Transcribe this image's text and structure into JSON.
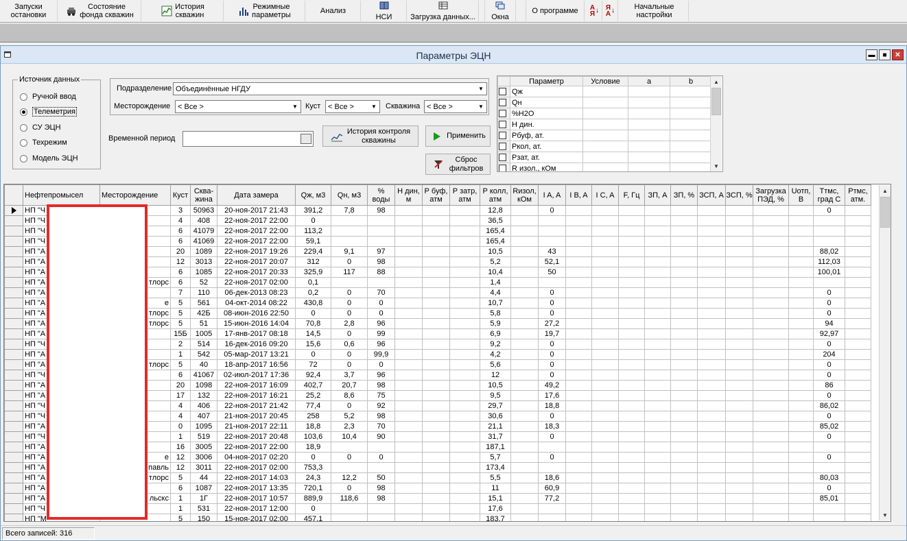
{
  "toolbar": {
    "buttons": [
      {
        "label": "Запуски\nостановки",
        "icon": ""
      },
      {
        "label": "Состояние\nфонда скважин",
        "icon": "car-icon"
      },
      {
        "label": "История\nскважин",
        "icon": "chart-history-icon"
      },
      {
        "label": "Режимные\nпараметры",
        "icon": "bar-chart-icon"
      },
      {
        "label": "Анализ",
        "icon": ""
      },
      {
        "label": "НСИ",
        "icon": "book-icon"
      },
      {
        "label": "Загрузка данных...",
        "icon": "grid-load-icon"
      },
      {
        "label": "Окна",
        "icon": "windows-icon"
      },
      {
        "label": "О программе",
        "icon": ""
      },
      {
        "label": "",
        "icon": "sort-ascending-icon"
      },
      {
        "label": "",
        "icon": "sort-descending-icon"
      },
      {
        "label": "Начальные\nнастройки",
        "icon": ""
      }
    ]
  },
  "window": {
    "title": "Параметры ЭЦН"
  },
  "source": {
    "legend": "Источник данных",
    "options": [
      "Ручной ввод",
      "Телеметрия",
      "СУ ЭЦН",
      "Техрежим",
      "Модель ЭЦН"
    ],
    "selected": "Телеметрия"
  },
  "filters": {
    "division_label": "Подразделение",
    "division_value": "Объединённые НГДУ",
    "field_label": "Месторождение",
    "field_value": "< Все >",
    "pad_label": "Куст",
    "pad_value": "< Все >",
    "well_label": "Скважина",
    "well_value": "< Все >",
    "period_label": "Временной период",
    "period_value": ""
  },
  "buttons": {
    "history": "История контроля\nскважины",
    "apply": "Применить",
    "reset": "Сброс\nфильтров"
  },
  "conditions": {
    "headers": [
      "Параметр",
      "Условие",
      "a",
      "b"
    ],
    "rows": [
      "Qж",
      "Qн",
      "%H2O",
      "Н дин.",
      "Рбуф, ат.",
      "Ркол, ат.",
      "Рзат, ат.",
      "R изол., кОм"
    ]
  },
  "grid": {
    "headers": [
      "Нефтепромысел",
      "Месторождение",
      "Куст",
      "Сква-\nжина",
      "Дата замера",
      "Qж, м3",
      "Qн, м3",
      "%\nводы",
      "Н дин,\nм",
      "Р буф,\nатм",
      "Р затр,\nатм",
      "Р колл,\nатм",
      "Rизол,\nкОм",
      "I A, A",
      "I B, A",
      "I C, A",
      "F, Гц",
      "ЗП, А",
      "ЗП, %",
      "ЗСП, А",
      "ЗСП, %",
      "Загрузка\nПЭД, %",
      "Uотп,\nВ",
      "Ттмс,\nград С",
      "Ртмс,\nатм."
    ],
    "rows": [
      [
        "НП \"Ч",
        "",
        "3",
        "50963",
        "20-ноя-2017 21:43",
        "391,2",
        "7,8",
        "98",
        "",
        "",
        "",
        "12,8",
        "",
        "0",
        "",
        "",
        "",
        "",
        "",
        "",
        "",
        "",
        "",
        "0",
        ""
      ],
      [
        "НП \"Ч",
        "",
        "4",
        "408",
        "22-ноя-2017 22:00",
        "0",
        "",
        "",
        "",
        "",
        "",
        "36,5",
        "",
        "",
        "",
        "",
        "",
        "",
        "",
        "",
        "",
        "",
        "",
        "",
        ""
      ],
      [
        "НП \"Ч",
        "",
        "6",
        "41079",
        "22-ноя-2017 22:00",
        "113,2",
        "",
        "",
        "",
        "",
        "",
        "165,4",
        "",
        "",
        "",
        "",
        "",
        "",
        "",
        "",
        "",
        "",
        "",
        "",
        ""
      ],
      [
        "НП \"Ч",
        "",
        "6",
        "41069",
        "22-ноя-2017 22:00",
        "59,1",
        "",
        "",
        "",
        "",
        "",
        "165,4",
        "",
        "",
        "",
        "",
        "",
        "",
        "",
        "",
        "",
        "",
        "",
        "",
        ""
      ],
      [
        "НП \"А",
        "",
        "20",
        "1089",
        "22-ноя-2017 19:26",
        "229,4",
        "9,1",
        "97",
        "",
        "",
        "",
        "10,5",
        "",
        "43",
        "",
        "",
        "",
        "",
        "",
        "",
        "",
        "",
        "",
        "88,02",
        ""
      ],
      [
        "НП \"А",
        "",
        "12",
        "3013",
        "22-ноя-2017 20:07",
        "312",
        "0",
        "98",
        "",
        "",
        "",
        "5,2",
        "",
        "52,1",
        "",
        "",
        "",
        "",
        "",
        "",
        "",
        "",
        "",
        "112,03",
        ""
      ],
      [
        "НП \"А",
        "",
        "6",
        "1085",
        "22-ноя-2017 20:33",
        "325,9",
        "117",
        "88",
        "",
        "",
        "",
        "10,4",
        "",
        "50",
        "",
        "",
        "",
        "",
        "",
        "",
        "",
        "",
        "",
        "100,01",
        ""
      ],
      [
        "НП \"А",
        "тлорс",
        "6",
        "52",
        "22-ноя-2017 02:00",
        "0,1",
        "",
        "",
        "",
        "",
        "",
        "1,4",
        "",
        "",
        "",
        "",
        "",
        "",
        "",
        "",
        "",
        "",
        "",
        "",
        ""
      ],
      [
        "НП \"А",
        "",
        "7",
        "110",
        "06-дек-2013 08:23",
        "0,2",
        "0",
        "70",
        "",
        "",
        "",
        "4,4",
        "",
        "0",
        "",
        "",
        "",
        "",
        "",
        "",
        "",
        "",
        "",
        "0",
        ""
      ],
      [
        "НП \"А",
        "е",
        "5",
        "561",
        "04-окт-2014 08:22",
        "430,8",
        "0",
        "0",
        "",
        "",
        "",
        "10,7",
        "",
        "0",
        "",
        "",
        "",
        "",
        "",
        "",
        "",
        "",
        "",
        "0",
        ""
      ],
      [
        "НП \"А",
        "тлорс",
        "5",
        "42Б",
        "08-июн-2016 22:50",
        "0",
        "0",
        "0",
        "",
        "",
        "",
        "5,8",
        "",
        "0",
        "",
        "",
        "",
        "",
        "",
        "",
        "",
        "",
        "",
        "0",
        ""
      ],
      [
        "НП \"А",
        "тлорс",
        "5",
        "51",
        "15-июн-2016 14:04",
        "70,8",
        "2,8",
        "96",
        "",
        "",
        "",
        "5,9",
        "",
        "27,2",
        "",
        "",
        "",
        "",
        "",
        "",
        "",
        "",
        "",
        "94",
        ""
      ],
      [
        "НП \"А",
        "",
        "15Б",
        "1005",
        "17-янв-2017 08:18",
        "14,5",
        "0",
        "99",
        "",
        "",
        "",
        "6,9",
        "",
        "19,7",
        "",
        "",
        "",
        "",
        "",
        "",
        "",
        "",
        "",
        "92,97",
        ""
      ],
      [
        "НП \"Ч",
        "",
        "2",
        "514",
        "16-дек-2016 09:20",
        "15,6",
        "0,6",
        "96",
        "",
        "",
        "",
        "9,2",
        "",
        "0",
        "",
        "",
        "",
        "",
        "",
        "",
        "",
        "",
        "",
        "0",
        ""
      ],
      [
        "НП \"А",
        "",
        "1",
        "542",
        "05-мар-2017 13:21",
        "0",
        "0",
        "99,9",
        "",
        "",
        "",
        "4,2",
        "",
        "0",
        "",
        "",
        "",
        "",
        "",
        "",
        "",
        "",
        "",
        "204",
        ""
      ],
      [
        "НП \"А",
        "тлорс",
        "5",
        "40",
        "18-апр-2017 16:56",
        "72",
        "0",
        "0",
        "",
        "",
        "",
        "5,6",
        "",
        "0",
        "",
        "",
        "",
        "",
        "",
        "",
        "",
        "",
        "",
        "0",
        ""
      ],
      [
        "НП \"Ч",
        "",
        "6",
        "41067",
        "02-июл-2017 17:36",
        "92,4",
        "3,7",
        "96",
        "",
        "",
        "",
        "12",
        "",
        "0",
        "",
        "",
        "",
        "",
        "",
        "",
        "",
        "",
        "",
        "0",
        ""
      ],
      [
        "НП \"А",
        "",
        "20",
        "1098",
        "22-ноя-2017 16:09",
        "402,7",
        "20,7",
        "98",
        "",
        "",
        "",
        "10,5",
        "",
        "49,2",
        "",
        "",
        "",
        "",
        "",
        "",
        "",
        "",
        "",
        "86",
        ""
      ],
      [
        "НП \"А",
        "",
        "17",
        "132",
        "22-ноя-2017 16:21",
        "25,2",
        "8,6",
        "75",
        "",
        "",
        "",
        "9,5",
        "",
        "17,6",
        "",
        "",
        "",
        "",
        "",
        "",
        "",
        "",
        "",
        "0",
        ""
      ],
      [
        "НП \"Ч",
        "",
        "4",
        "406",
        "22-ноя-2017 21:42",
        "77,4",
        "0",
        "92",
        "",
        "",
        "",
        "29,7",
        "",
        "18,8",
        "",
        "",
        "",
        "",
        "",
        "",
        "",
        "",
        "",
        "86,02",
        ""
      ],
      [
        "НП \"Ч",
        "",
        "4",
        "407",
        "21-ноя-2017 20:45",
        "258",
        "5,2",
        "98",
        "",
        "",
        "",
        "30,6",
        "",
        "0",
        "",
        "",
        "",
        "",
        "",
        "",
        "",
        "",
        "",
        "0",
        ""
      ],
      [
        "НП \"А",
        "",
        "0",
        "1095",
        "21-ноя-2017 22:11",
        "18,8",
        "2,3",
        "70",
        "",
        "",
        "",
        "21,1",
        "",
        "18,3",
        "",
        "",
        "",
        "",
        "",
        "",
        "",
        "",
        "",
        "85,02",
        ""
      ],
      [
        "НП \"Ч",
        "",
        "1",
        "519",
        "22-ноя-2017 20:48",
        "103,6",
        "10,4",
        "90",
        "",
        "",
        "",
        "31,7",
        "",
        "0",
        "",
        "",
        "",
        "",
        "",
        "",
        "",
        "",
        "",
        "0",
        ""
      ],
      [
        "НП \"А",
        "",
        "16",
        "3005",
        "22-ноя-2017 22:00",
        "18,9",
        "",
        "",
        "",
        "",
        "",
        "187,1",
        "",
        "",
        "",
        "",
        "",
        "",
        "",
        "",
        "",
        "",
        "",
        "",
        ""
      ],
      [
        "НП \"А",
        "е",
        "12",
        "3006",
        "04-ноя-2017 02:20",
        "0",
        "0",
        "0",
        "",
        "",
        "",
        "5,7",
        "",
        "0",
        "",
        "",
        "",
        "",
        "",
        "",
        "",
        "",
        "",
        "0",
        ""
      ],
      [
        "НП \"А",
        "павль",
        "12",
        "3011",
        "22-ноя-2017 02:00",
        "753,3",
        "",
        "",
        "",
        "",
        "",
        "173,4",
        "",
        "",
        "",
        "",
        "",
        "",
        "",
        "",
        "",
        "",
        "",
        "",
        ""
      ],
      [
        "НП \"А",
        "тлорс",
        "5",
        "44",
        "22-ноя-2017 14:03",
        "24,3",
        "12,2",
        "50",
        "",
        "",
        "",
        "5,5",
        "",
        "18,6",
        "",
        "",
        "",
        "",
        "",
        "",
        "",
        "",
        "",
        "80,03",
        ""
      ],
      [
        "НП \"А",
        "",
        "6",
        "1087",
        "22-ноя-2017 13:35",
        "720,1",
        "0",
        "98",
        "",
        "",
        "",
        "11",
        "",
        "60,9",
        "",
        "",
        "",
        "",
        "",
        "",
        "",
        "",
        "",
        "0",
        ""
      ],
      [
        "НП \"А",
        "льскс",
        "1",
        "1Г",
        "22-ноя-2017 10:57",
        "889,9",
        "118,6",
        "98",
        "",
        "",
        "",
        "15,1",
        "",
        "77,2",
        "",
        "",
        "",
        "",
        "",
        "",
        "",
        "",
        "",
        "85,01",
        ""
      ],
      [
        "НП \"Ч",
        "",
        "1",
        "531",
        "22-ноя-2017 12:00",
        "0",
        "",
        "",
        "",
        "",
        "",
        "17,6",
        "",
        "",
        "",
        "",
        "",
        "",
        "",
        "",
        "",
        "",
        "",
        "",
        ""
      ],
      [
        "НП \"М",
        "",
        "5",
        "150",
        "15-ноя-2017 02:00",
        "457,1",
        "",
        "",
        "",
        "",
        "",
        "183,7",
        "",
        "",
        "",
        "",
        "",
        "",
        "",
        "",
        "",
        "",
        "",
        "",
        ""
      ]
    ]
  },
  "status": {
    "label": "Всего записей:",
    "count": "316"
  }
}
